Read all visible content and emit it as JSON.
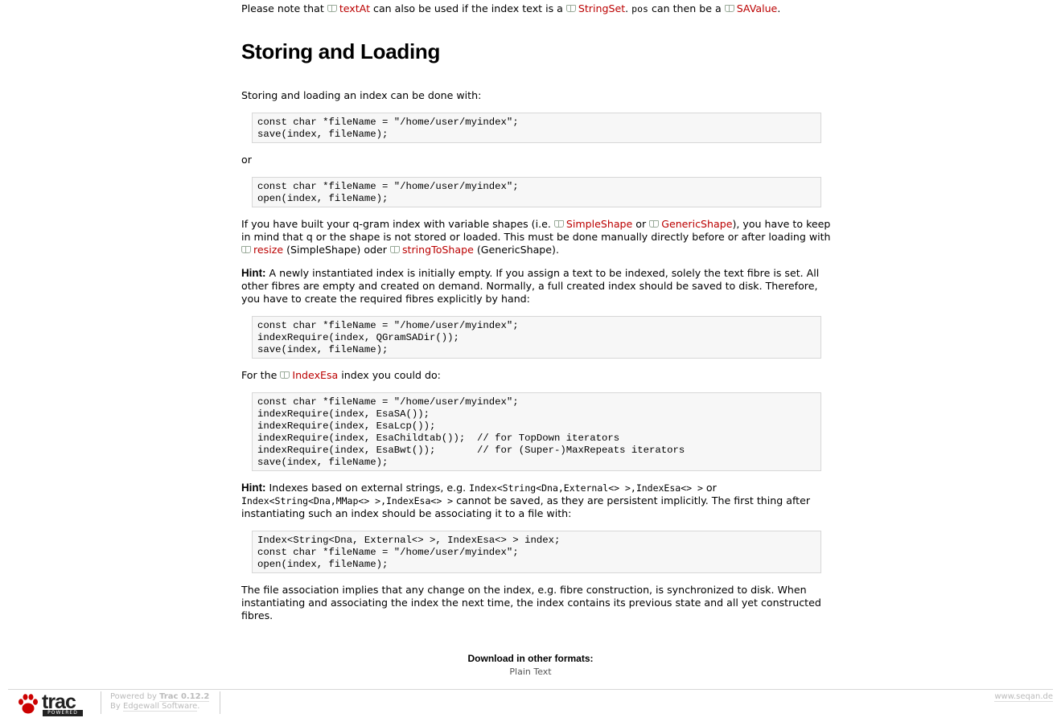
{
  "intro": {
    "pre": "Please note that ",
    "link_textat": "textAt",
    "mid1": " can also be used if the index text is a ",
    "link_stringset": "StringSet",
    "mid2": ". ",
    "pos_code": "pos",
    "mid3": " can then be a ",
    "link_savalue": "SAValue",
    "end": "."
  },
  "heading": "Storing and Loading",
  "p1": "Storing and loading an index can be done with:",
  "code1": "const char *fileName = \"/home/user/myindex\";\nsave(index, fileName);",
  "or_text": "or",
  "code2": "const char *fileName = \"/home/user/myindex\";\nopen(index, fileName);",
  "p_shapes": {
    "t1": "If you have built your q-gram index with variable shapes (i.e. ",
    "link_simpleshape": "SimpleShape",
    "t2": " or ",
    "link_genericshape": "GenericShape",
    "t3": "), you have to keep in mind that q or the shape is not stored or loaded. This must be done manually directly before or after loading with ",
    "link_resize": "resize",
    "t4": " (SimpleShape) oder ",
    "link_stringtoshape": "stringToShape",
    "t5": " (GenericShape)."
  },
  "hint1": {
    "label": "Hint:",
    "text": " A newly instantiated index is initially empty. If you assign a text to be indexed, solely the text fibre is set. All other fibres are empty and created on demand. Normally, a full created index should be saved to disk. Therefore, you have to create the required fibres explicitly by hand:"
  },
  "code3": "const char *fileName = \"/home/user/myindex\";\nindexRequire(index, QGramSADir());\nsave(index, fileName);",
  "p_esa": {
    "pre": "For the ",
    "link_indexesa": "IndexEsa",
    "post": " index you could do:"
  },
  "code4": "const char *fileName = \"/home/user/myindex\";\nindexRequire(index, EsaSA());\nindexRequire(index, EsaLcp());\nindexRequire(index, EsaChildtab());  // for TopDown iterators\nindexRequire(index, EsaBwt());       // for (Super-)MaxRepeats iterators\nsave(index, fileName);",
  "hint2": {
    "label": "Hint:",
    "t1": " Indexes based on external strings, e.g. ",
    "c1": "Index<String<Dna,External<> >,IndexEsa<> >",
    "t2": " or ",
    "c2": "Index<String<Dna,MMap<> >,IndexEsa<> >",
    "t3": " cannot be saved, as they are persistent implicitly. The first thing after instantiating such an index should be associating it to a file with:"
  },
  "code5": "Index<String<Dna, External<> >, IndexEsa<> > index;\nconst char *fileName = \"/home/user/myindex\";\nopen(index, fileName);",
  "p_final": "The file association implies that any change on the index, e.g. fibre construction, is synchronized to disk. When instantiating and associating the index the next time, the index contains its previous state and all yet constructed fibres.",
  "altlinks": {
    "heading": "Download in other formats:",
    "plain_text": "Plain Text"
  },
  "footer": {
    "logo_text": "trac",
    "logo_badge": "POWERED",
    "powered_by": "Powered by ",
    "trac_version": "Trac 0.12.2",
    "by": "By ",
    "edgewall": "Edgewall Software",
    "by_end": ".",
    "site_url": "www.seqan.de"
  },
  "colors": {
    "link": "#bb0000",
    "code_bg": "#f7f7f7",
    "code_border": "#d7d7d7"
  }
}
